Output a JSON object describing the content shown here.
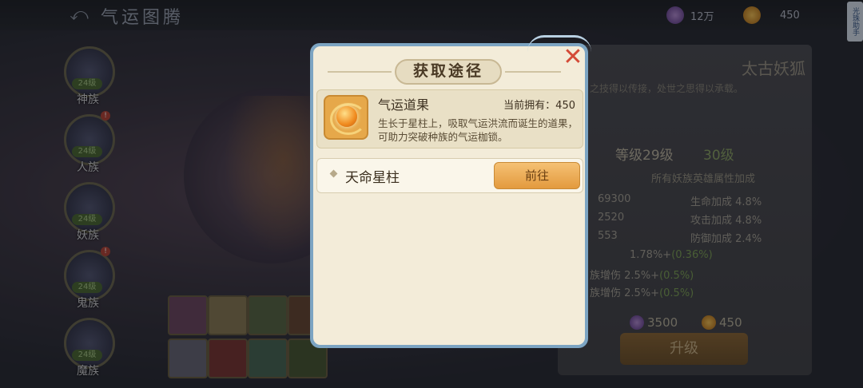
{
  "header": {
    "back_icon": "back-arrow-icon",
    "title": "气运图腾",
    "resources": [
      {
        "icon": "purple-crystal-icon",
        "value": "12万"
      },
      {
        "icon": "golden-orb-icon",
        "value": "450"
      }
    ],
    "helper_label": "光珠助手"
  },
  "sidebar": {
    "tribes": [
      {
        "name": "神族",
        "level": "24级",
        "badge": ""
      },
      {
        "name": "人族",
        "level": "24级",
        "badge": "!"
      },
      {
        "name": "妖族",
        "level": "24级",
        "badge": ""
      },
      {
        "name": "鬼族",
        "level": "24级",
        "badge": "!"
      },
      {
        "name": "魔族",
        "level": "24级",
        "badge": ""
      }
    ]
  },
  "right_panel": {
    "hero_name": "太古妖狐",
    "description": "之技得以传接，处世之思得以承载。",
    "level_current": "等级29级",
    "level_next": "30级",
    "bonus_title": "所有妖族英雄属性加成",
    "stats": [
      {
        "value": "69300",
        "label": "生命加成",
        "pct": "4.8%"
      },
      {
        "value": "2520",
        "label": "攻击加成",
        "pct": "4.8%"
      },
      {
        "value": "553",
        "label": "防御加成",
        "pct": "2.4%"
      }
    ],
    "extra_stats": [
      {
        "label": "",
        "base": "1.78%+",
        "bonus": "(0.36%)"
      },
      {
        "label": "族增伤",
        "base": "2.5%+",
        "bonus": "(0.5%)"
      },
      {
        "label": "族增伤",
        "base": "2.5%+",
        "bonus": "(0.5%)"
      }
    ],
    "cost_crystal": "3500",
    "cost_orb": "450",
    "upgrade_label": "升级"
  },
  "modal": {
    "title": "获取途径",
    "close_icon": "close-x-icon",
    "item": {
      "icon": "fortune-fruit-icon",
      "name": "气运道果",
      "owned_label": "当前拥有：",
      "owned_value": "450",
      "description": "生长于星柱上，吸取气运洪流而诞生的道果，可助力突破种族的气运枷锁。"
    },
    "routes": [
      {
        "name": "天命星柱",
        "button": "前往"
      }
    ]
  },
  "colors": {
    "modal_border": "#7ca4c2",
    "modal_bg": "#f3ecd9",
    "close_red": "#d44a37",
    "go_button": "#e39a3e",
    "bonus_green": "#7ea25c"
  }
}
